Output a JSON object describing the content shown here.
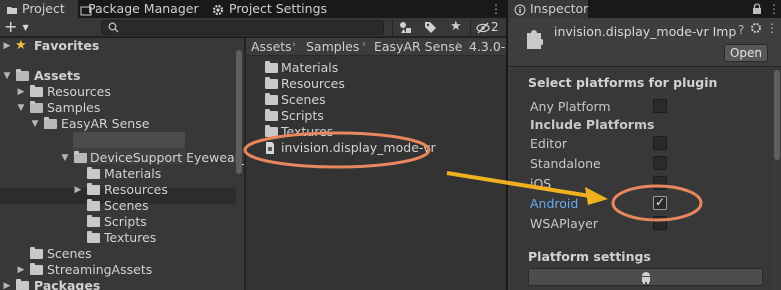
{
  "tabs": [
    {
      "label": "Project",
      "icon": "folder-icon"
    },
    {
      "label": "Package Manager",
      "icon": "package-icon"
    },
    {
      "label": "Project Settings",
      "icon": "gear-icon"
    },
    {
      "label": "Inspector",
      "icon": "info-icon"
    }
  ],
  "toolbar": {
    "add_label": "+",
    "search_placeholder": "",
    "hidden_count": "2"
  },
  "tree": {
    "favorites": "Favorites",
    "assets": "Assets",
    "resources": "Resources",
    "samples": "Samples",
    "easyar": "EasyAR Sense",
    "devicesupport": "DeviceSupport Eyewear_I",
    "materials": "Materials",
    "resources2": "Resources",
    "scenes": "Scenes",
    "scripts": "Scripts",
    "textures": "Textures",
    "scenes_root": "Scenes",
    "streaming": "StreamingAssets",
    "packages": "Packages"
  },
  "breadcrumb": [
    "Assets",
    "Samples",
    "EasyAR Sense",
    "4.3.0-"
  ],
  "files": {
    "materials": "Materials",
    "resources": "Resources",
    "scenes": "Scenes",
    "scripts": "Scripts",
    "textures": "Textures",
    "plugin": "invision.display_mode-vr"
  },
  "inspector": {
    "title": "invision.display_mode-vr Imp",
    "open_button": "Open",
    "select_platforms": "Select platforms for plugin",
    "any_platform": "Any Platform",
    "include_platforms": "Include Platforms",
    "platforms": [
      {
        "name": "Editor",
        "checked": false,
        "selected": false
      },
      {
        "name": "Standalone",
        "checked": false,
        "selected": false
      },
      {
        "name": "iOS",
        "checked": false,
        "selected": false
      },
      {
        "name": "Android",
        "checked": true,
        "selected": true
      },
      {
        "name": "WSAPlayer",
        "checked": false,
        "selected": false
      }
    ],
    "platform_settings": "Platform settings"
  },
  "colors": {
    "annotation": "#e8875e",
    "arrow": "#f0b020",
    "favorites_star": "#f0c040",
    "selected_text": "#6aa8f0"
  }
}
